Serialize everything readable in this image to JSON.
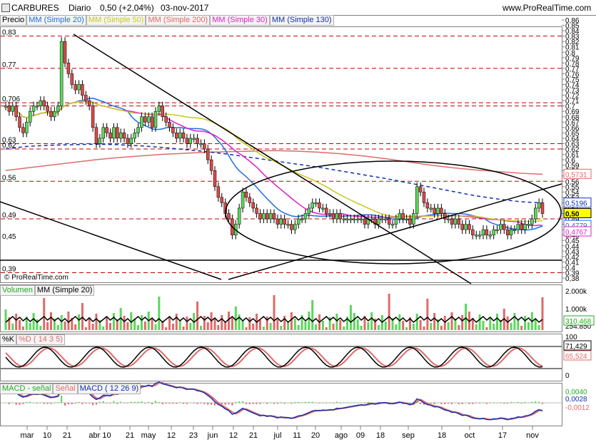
{
  "header": {
    "symbol": "CARBURES",
    "period": "Diario",
    "price_change": "0,50 (+2,04%)",
    "date": "03-nov-2017",
    "site": "www.ProRealTime.com"
  },
  "price_legend": {
    "price": "Precio",
    "items": [
      {
        "label": "MM (Simple 20)",
        "color": "#1e6fe0"
      },
      {
        "label": "MM (Simple 50)",
        "color": "#c8c81e"
      },
      {
        "label": "MM (Simple 200)",
        "color": "#e06a6a"
      },
      {
        "label": "MM (Simple 30)",
        "color": "#e020c8"
      },
      {
        "label": "MM (Simple 130)",
        "color": "#1030b0"
      }
    ]
  },
  "watermark": "© ProRealTime.com",
  "price_axis": [
    "0,86",
    "0,85",
    "0,84",
    "0,83",
    "0,82",
    "0,81",
    "0,8",
    "0,79",
    "0,78",
    "0,77",
    "0,76",
    "0,75",
    "0,74",
    "0,73",
    "0,72",
    "0,71",
    "0,7",
    "0,69",
    "0,68",
    "0,67",
    "0,66",
    "0,65",
    "0,64",
    "0,63",
    "0,62",
    "0,61",
    "0,6",
    "0,59",
    "0,58",
    "0,57",
    "0,56",
    "0,55",
    "0,54",
    "0,53",
    "0,52",
    "0,51",
    "0,5",
    "0,49",
    "0,48",
    "0,47",
    "0,46",
    "0,45",
    "0,44",
    "0,43",
    "0,42",
    "0,41",
    "0,4",
    "0,39",
    "0,38"
  ],
  "left_levels": [
    "0,83",
    "0,77",
    "0,706",
    "0,63",
    "0,62",
    "0,56",
    "0,49",
    "0,45",
    "0,39"
  ],
  "price_badges": {
    "ma200": "0,5731",
    "ma130": "0,5196",
    "price": "0,50",
    "ma20": "0,4779",
    "ma30": "0,4767"
  },
  "volume": {
    "title": "Volumen",
    "ma_label": "MM (Simple 20)",
    "axis": [
      "2.000k",
      "1.000k",
      "254.850"
    ],
    "badge": "310.468"
  },
  "stoch": {
    "k_label": "%K",
    "d_label": "%D ( 14 3 5)",
    "axis": [
      "100",
      "50",
      "0"
    ],
    "k_value": "71,429",
    "d_value": "65,524"
  },
  "macd": {
    "hist_label": "MACD - señal",
    "signal_label": "Señal",
    "macd_label": "MACD ( 12 26 9)",
    "v1": "0,0040",
    "v2": "0,0028",
    "v3": "-0,0012"
  },
  "x_axis": [
    "mar",
    "10",
    "21",
    "abr 10",
    "21",
    "may",
    "12",
    "23",
    "jun",
    "12",
    "21",
    "jul",
    "11",
    "20",
    "ago",
    "09",
    "18",
    "sep",
    "18",
    "oct",
    "17",
    "nov"
  ],
  "chart_data": {
    "type": "candlestick",
    "title": "CARBURES Diario",
    "ylim": [
      0.38,
      0.86
    ],
    "close": [
      0.7,
      0.69,
      0.7,
      0.68,
      0.66,
      0.65,
      0.67,
      0.69,
      0.7,
      0.7,
      0.71,
      0.7,
      0.69,
      0.68,
      0.69,
      0.7,
      0.82,
      0.78,
      0.76,
      0.74,
      0.73,
      0.74,
      0.72,
      0.71,
      0.7,
      0.66,
      0.63,
      0.64,
      0.66,
      0.65,
      0.64,
      0.66,
      0.64,
      0.65,
      0.64,
      0.63,
      0.64,
      0.65,
      0.66,
      0.68,
      0.67,
      0.68,
      0.66,
      0.69,
      0.7,
      0.68,
      0.67,
      0.66,
      0.65,
      0.64,
      0.65,
      0.64,
      0.63,
      0.64,
      0.64,
      0.63,
      0.63,
      0.62,
      0.6,
      0.58,
      0.55,
      0.53,
      0.52,
      0.5,
      0.49,
      0.46,
      0.48,
      0.51,
      0.54,
      0.53,
      0.52,
      0.51,
      0.5,
      0.49,
      0.5,
      0.49,
      0.5,
      0.49,
      0.48,
      0.49,
      0.48,
      0.48,
      0.47,
      0.48,
      0.49,
      0.49,
      0.5,
      0.51,
      0.52,
      0.52,
      0.51,
      0.51,
      0.5,
      0.5,
      0.49,
      0.5,
      0.49,
      0.49,
      0.49,
      0.49,
      0.49,
      0.49,
      0.49,
      0.48,
      0.49,
      0.49,
      0.48,
      0.49,
      0.49,
      0.49,
      0.48,
      0.48,
      0.49,
      0.5,
      0.49,
      0.49,
      0.48,
      0.5,
      0.55,
      0.54,
      0.52,
      0.51,
      0.51,
      0.5,
      0.51,
      0.5,
      0.49,
      0.49,
      0.48,
      0.49,
      0.48,
      0.47,
      0.48,
      0.47,
      0.46,
      0.46,
      0.46,
      0.47,
      0.46,
      0.46,
      0.47,
      0.47,
      0.48,
      0.47,
      0.46,
      0.47,
      0.47,
      0.48,
      0.47,
      0.48,
      0.48,
      0.49,
      0.51,
      0.52,
      0.5
    ],
    "ma": [
      {
        "name": "MM (Simple 200)",
        "values": [
          0.58,
          0.585,
          0.59,
          0.595,
          0.6,
          0.604,
          0.607,
          0.61,
          0.612,
          0.614,
          0.615,
          0.616,
          0.617,
          0.616,
          0.614,
          0.611,
          0.607,
          0.602,
          0.596,
          0.59,
          0.585,
          0.581,
          0.578,
          0.575,
          0.573
        ]
      },
      {
        "name": "MM (Simple 130)",
        "values": [
          0.62,
          0.625,
          0.627,
          0.628,
          0.629,
          0.628,
          0.626,
          0.623,
          0.619,
          0.615,
          0.61,
          0.604,
          0.598,
          0.592,
          0.586,
          0.579,
          0.572,
          0.565,
          0.557,
          0.549,
          0.541,
          0.533,
          0.527,
          0.522,
          0.5196
        ]
      }
    ]
  }
}
